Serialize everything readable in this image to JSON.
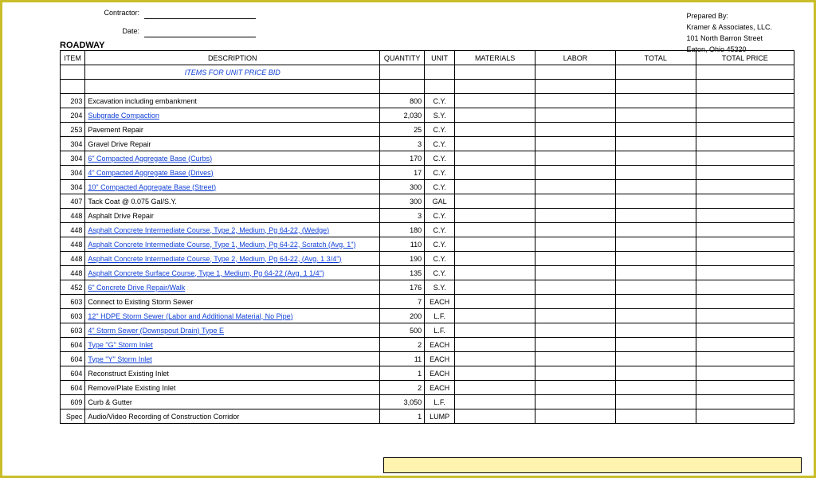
{
  "header": {
    "contractor_label": "Contractor:",
    "date_label": "Date:",
    "prepared_by_label": "Prepared By:",
    "prepared_by_name": "Kramer & Associates, LLC.",
    "prepared_by_addr1": "101 North Barron Street",
    "prepared_by_addr2": "Eaton, Ohio 45320"
  },
  "section_title": "ROADWAY",
  "columns": {
    "item": "ITEM",
    "description": "DESCRIPTION",
    "quantity": "QUANTITY",
    "unit": "UNIT",
    "materials": "MATERIALS",
    "labor": "LABOR",
    "total": "TOTAL",
    "total_price": "TOTAL PRICE"
  },
  "sub_header": "ITEMS FOR UNIT PRICE BID",
  "rows": [
    {
      "item": "203",
      "desc": "Excavation including embankment",
      "qty": "800",
      "unit": "C.Y.",
      "blank_above": true
    },
    {
      "item": "204",
      "desc": "Subgrade Compaction",
      "link": true,
      "qty": "2,030",
      "unit": "S.Y."
    },
    {
      "item": "253",
      "desc": "Pavement Repair",
      "qty": "25",
      "unit": "C.Y."
    },
    {
      "item": "304",
      "desc": "Gravel Drive Repair",
      "qty": "3",
      "unit": "C.Y."
    },
    {
      "item": "304",
      "desc": "6\" Compacted Aggregate Base (Curbs)",
      "link": true,
      "qty": "170",
      "unit": "C.Y."
    },
    {
      "item": "304",
      "desc": "4\" Compacted Aggregate Base (Drives)",
      "link": true,
      "qty": "17",
      "unit": "C.Y."
    },
    {
      "item": "304",
      "desc": "10\" Compacted Aggregate Base (Street)",
      "link": true,
      "qty": "300",
      "unit": "C.Y."
    },
    {
      "item": "407",
      "desc": "Tack Coat @ 0.075 Gal/S.Y.",
      "qty": "300",
      "unit": "GAL"
    },
    {
      "item": "448",
      "desc": "Asphalt Drive Repair",
      "qty": "3",
      "unit": "C.Y."
    },
    {
      "item": "448",
      "desc": "Asphalt Concrete Intermediate Course, Type 2, Medium, Pg 64-22, (Wedge)",
      "link": true,
      "qty": "180",
      "unit": "C.Y."
    },
    {
      "item": "448",
      "desc": "Asphalt Concrete Intermediate Course, Type 1, Medium, Pg 64-22, Scratch (Avg. 1\")",
      "link": true,
      "qty": "110",
      "unit": "C.Y."
    },
    {
      "item": "448",
      "desc": "Asphalt Concrete Intermediate Course, Type 2, Medium, Pg 64-22, (Avg. 1 3/4\")",
      "link": true,
      "qty": "190",
      "unit": "C.Y."
    },
    {
      "item": "448",
      "desc": "Asphalt Concrete Surface Course, Type 1, Medium, Pg 64-22 (Avg. 1 1/4\")",
      "link": true,
      "qty": "135",
      "unit": "C.Y."
    },
    {
      "item": "452",
      "desc": "6\" Concrete Drive Repair/Walk",
      "link": true,
      "qty": "176",
      "unit": "S.Y."
    },
    {
      "item": "603",
      "desc": "Connect to Existing Storm Sewer",
      "qty": "7",
      "unit": "EACH"
    },
    {
      "item": "603",
      "desc": "12\" HDPE Storm Sewer  (Labor and Additional Material, No Pipe)",
      "link": true,
      "qty": "200",
      "unit": "L.F."
    },
    {
      "item": "603",
      "desc": "4\" Storm Sewer (Downspout Drain) Type E",
      "link": true,
      "qty": "500",
      "unit": "L.F."
    },
    {
      "item": "604",
      "desc": "Type \"G\" Storm Inlet",
      "link": true,
      "qty": "2",
      "unit": "EACH"
    },
    {
      "item": "604",
      "desc": "Type \"Y\" Storm Inlet",
      "link": true,
      "qty": "11",
      "unit": "EACH"
    },
    {
      "item": "604",
      "desc": "Reconstruct Existing Inlet",
      "qty": "1",
      "unit": "EACH"
    },
    {
      "item": "604",
      "desc": "Remove/Plate Existing Inlet",
      "qty": "2",
      "unit": "EACH"
    },
    {
      "item": "609",
      "desc": "Curb & Gutter",
      "qty": "3,050",
      "unit": "L.F."
    },
    {
      "item": "Spec",
      "desc": "Audio/Video Recording of Construction Corridor",
      "qty": "1",
      "unit": "LUMP"
    }
  ]
}
